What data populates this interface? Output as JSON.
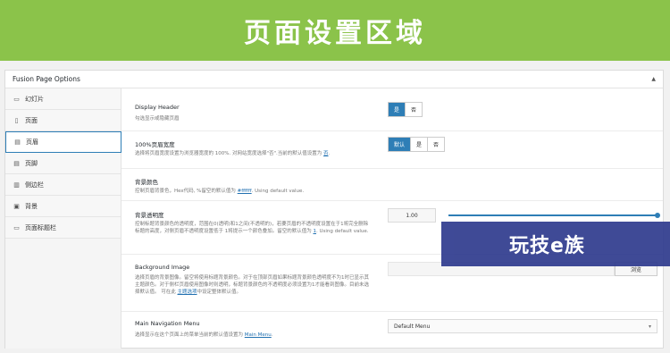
{
  "banner": {
    "title": "页面设置区域"
  },
  "panel": {
    "title": "Fusion Page Options",
    "toggle_icon": "triangle-up"
  },
  "sidebar": {
    "items": [
      {
        "label": "幻灯片",
        "icon": "slides-icon"
      },
      {
        "label": "页面",
        "icon": "page-icon"
      },
      {
        "label": "页眉",
        "icon": "header-icon"
      },
      {
        "label": "页脚",
        "icon": "footer-icon"
      },
      {
        "label": "侧边栏",
        "icon": "sidebar-icon"
      },
      {
        "label": "背景",
        "icon": "image-icon"
      },
      {
        "label": "页面标题栏",
        "icon": "titlebar-icon"
      }
    ],
    "active_index": 2
  },
  "rows": {
    "display_header": {
      "label": "Display Header",
      "desc": "勾选显示或隐藏页眉",
      "options": [
        "是",
        "否"
      ],
      "selected": "是"
    },
    "full_width": {
      "label": "100%页眉宽度",
      "desc_pre": "选择将页眉宽度设置为浏览器宽度的 100%. 对网站宽度选择\"否\".当前的默认值设置为 ",
      "desc_link": "否",
      "desc_post": ".",
      "options": [
        "默认",
        "是",
        "否"
      ],
      "selected": "默认"
    },
    "bg_color": {
      "label": "背景颜色",
      "desc_pre": "控制页眉背景色，Hex代码, %留空的默认值为 ",
      "desc_link": "#ffffff",
      "desc_post": ". Using default value."
    },
    "bg_opacity": {
      "label": "背景透明度",
      "desc_pre": "控制标题背景颜色的透明度，范围在0(透明)和1之间(不透明的)，若要页眉的不透明度设置在于1将完全删除标题的高度，对侧页眉不透明度设置低于 1将提示一个颜色叠加。留空的默认值为 ",
      "desc_link": "1",
      "desc_post": ". Using default value.",
      "value": "1.00",
      "slider_fraction": 1.0
    },
    "bg_image": {
      "label": "Background Image",
      "desc_pre": "选择页眉的背景图像。留空将使用标题背景颜色。对于在顶部页眉如果标题背景颜色透明度不为1时已显示其主题颜色。对于侧栏页眉使用图像时则透明，标题背景颜色的不透明度必须设置为1才能看到图像。目前未选择默认值。 可在此 ",
      "desc_link": "主题选项",
      "desc_post": "中设定整体默认值。",
      "browse_label": "浏览"
    },
    "main_menu": {
      "label": "Main Navigation Menu",
      "desc_pre": "选择显示在这个页面上的菜单当前的默认值设置为 ",
      "desc_link": "Main Menu",
      "desc_post": ".",
      "selected": "Default Menu"
    }
  },
  "watermark": {
    "text": "玩技e族"
  },
  "colors": {
    "banner": "#8bc34a",
    "accent": "#2e7eb6",
    "watermark": "#2f3b8e"
  }
}
